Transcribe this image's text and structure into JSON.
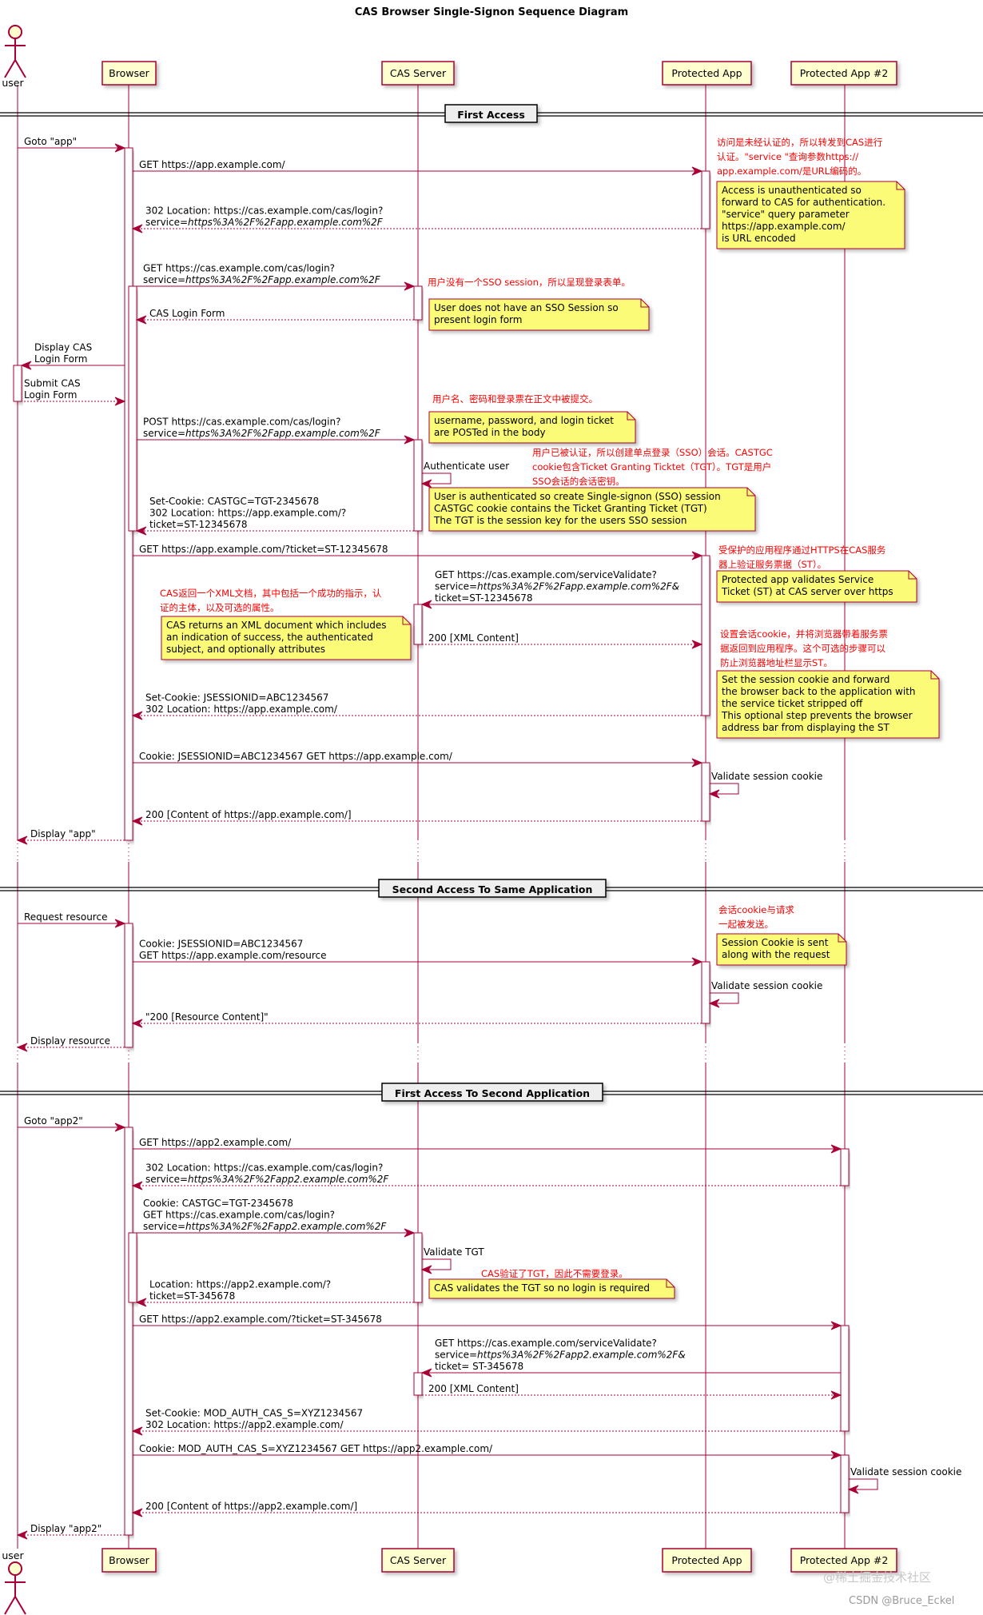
{
  "title": "CAS Browser Single-Signon Sequence Diagram",
  "colors": {
    "line": "#A80036",
    "participant_fill": "#FEFECE",
    "note_fill": "#FBFB77",
    "annotation_text": "#FF0000",
    "divider_fill": "#EEEEEE"
  },
  "participants": [
    {
      "id": "user",
      "label": "user",
      "type": "actor"
    },
    {
      "id": "browser",
      "label": "Browser",
      "type": "participant"
    },
    {
      "id": "cas",
      "label": "CAS Server",
      "type": "participant"
    },
    {
      "id": "app",
      "label": "Protected App",
      "type": "participant"
    },
    {
      "id": "app2",
      "label": "Protected App #2",
      "type": "participant"
    }
  ],
  "dividers": [
    {
      "label": "First Access"
    },
    {
      "label": "Second Access To Same Application"
    },
    {
      "label": "First Access To Second Application"
    }
  ],
  "messages": [
    {
      "from": "user",
      "to": "browser",
      "style": "solid",
      "lines": [
        "Goto \"app\""
      ]
    },
    {
      "from": "browser",
      "to": "app",
      "style": "solid",
      "lines": [
        "GET https://app.example.com/"
      ]
    },
    {
      "from": "app",
      "to": "browser",
      "style": "dashed",
      "lines": [
        "302 Location: https://cas.example.com/cas/login?",
        "service=|https%3A%2F%2Fapp.example.com%2F"
      ]
    },
    {
      "from": "browser",
      "to": "cas",
      "style": "solid",
      "lines": [
        "GET https://cas.example.com/cas/login?",
        "service=|https%3A%2F%2Fapp.example.com%2F"
      ]
    },
    {
      "from": "cas",
      "to": "browser",
      "style": "dashed",
      "lines": [
        "CAS Login Form"
      ]
    },
    {
      "from": "browser",
      "to": "user",
      "style": "solid",
      "lines": [
        "Display CAS",
        "Login Form"
      ]
    },
    {
      "from": "user",
      "to": "browser",
      "style": "dashed",
      "lines": [
        "Submit CAS",
        "Login Form"
      ]
    },
    {
      "from": "browser",
      "to": "cas",
      "style": "solid",
      "lines": [
        "POST https://cas.example.com/cas/login?",
        "service=|https%3A%2F%2Fapp.example.com%2F"
      ]
    },
    {
      "from": "cas",
      "to": "cas",
      "style": "self",
      "lines": [
        "Authenticate user"
      ]
    },
    {
      "from": "cas",
      "to": "browser",
      "style": "dashed",
      "lines": [
        "Set-Cookie: CASTGC=TGT-2345678",
        "302 Location: https://app.example.com/?",
        "ticket=ST-12345678"
      ]
    },
    {
      "from": "browser",
      "to": "app",
      "style": "solid",
      "lines": [
        "GET https://app.example.com/?ticket=ST-12345678"
      ]
    },
    {
      "from": "app",
      "to": "cas",
      "style": "solid",
      "lines": [
        "GET https://cas.example.com/serviceValidate?",
        "service=|https%3A%2F%2Fapp.example.com%2F&",
        "ticket=ST-12345678"
      ]
    },
    {
      "from": "cas",
      "to": "app",
      "style": "dashed",
      "lines": [
        "200 [XML Content]"
      ]
    },
    {
      "from": "app",
      "to": "browser",
      "style": "dashed",
      "lines": [
        "Set-Cookie: JSESSIONID=ABC1234567",
        "302 Location: https://app.example.com/"
      ]
    },
    {
      "from": "browser",
      "to": "app",
      "style": "solid",
      "lines": [
        "Cookie: JSESSIONID=ABC1234567 GET https://app.example.com/"
      ]
    },
    {
      "from": "app",
      "to": "app",
      "style": "self",
      "lines": [
        "Validate session cookie"
      ]
    },
    {
      "from": "app",
      "to": "browser",
      "style": "dashed",
      "lines": [
        "200 [Content of https://app.example.com/]"
      ]
    },
    {
      "from": "browser",
      "to": "user",
      "style": "dashed",
      "lines": [
        "Display \"app\""
      ]
    },
    {
      "from": "user",
      "to": "browser",
      "style": "solid",
      "lines": [
        "Request resource"
      ]
    },
    {
      "from": "browser",
      "to": "app",
      "style": "solid",
      "lines": [
        "Cookie: JSESSIONID=ABC1234567",
        "GET https://app.example.com/resource"
      ]
    },
    {
      "from": "app",
      "to": "app",
      "style": "self",
      "lines": [
        "Validate session cookie"
      ]
    },
    {
      "from": "app",
      "to": "browser",
      "style": "dashed",
      "lines": [
        "\"200 [Resource Content]\""
      ]
    },
    {
      "from": "browser",
      "to": "user",
      "style": "dashed",
      "lines": [
        "Display resource"
      ]
    },
    {
      "from": "user",
      "to": "browser",
      "style": "solid",
      "lines": [
        "Goto \"app2\""
      ]
    },
    {
      "from": "browser",
      "to": "app2",
      "style": "solid",
      "lines": [
        "GET https://app2.example.com/"
      ]
    },
    {
      "from": "app2",
      "to": "browser",
      "style": "dashed",
      "lines": [
        "302 Location: https://cas.example.com/cas/login?",
        "service=|https%3A%2F%2Fapp2.example.com%2F"
      ]
    },
    {
      "from": "browser",
      "to": "cas",
      "style": "solid",
      "lines": [
        "Cookie: CASTGC=TGT-2345678",
        "GET https://cas.example.com/cas/login?",
        "service=|https%3A%2F%2Fapp2.example.com%2F"
      ]
    },
    {
      "from": "cas",
      "to": "cas",
      "style": "self",
      "lines": [
        "Validate TGT"
      ]
    },
    {
      "from": "cas",
      "to": "browser",
      "style": "dashed",
      "lines": [
        "Location: https://app2.example.com/?",
        "ticket=ST-345678"
      ]
    },
    {
      "from": "browser",
      "to": "app2",
      "style": "solid",
      "lines": [
        "GET https://app2.example.com/?ticket=ST-345678"
      ]
    },
    {
      "from": "app2",
      "to": "cas",
      "style": "solid",
      "lines": [
        "GET https://cas.example.com/serviceValidate?",
        "service=|https%3A%2F%2Fapp2.example.com%2F&",
        "ticket= ST-345678"
      ]
    },
    {
      "from": "cas",
      "to": "app2",
      "style": "dashed",
      "lines": [
        "200 [XML Content]"
      ]
    },
    {
      "from": "app2",
      "to": "browser",
      "style": "dashed",
      "lines": [
        "Set-Cookie: MOD_AUTH_CAS_S=XYZ1234567",
        "302 Location: https://app2.example.com/"
      ]
    },
    {
      "from": "browser",
      "to": "app2",
      "style": "solid",
      "lines": [
        "Cookie: MOD_AUTH_CAS_S=XYZ1234567 GET https://app2.example.com/"
      ]
    },
    {
      "from": "app2",
      "to": "app2",
      "style": "self",
      "lines": [
        "Validate session cookie"
      ]
    },
    {
      "from": "app2",
      "to": "browser",
      "style": "dashed",
      "lines": [
        "200 [Content of https://app2.example.com/]"
      ]
    },
    {
      "from": "browser",
      "to": "user",
      "style": "dashed",
      "lines": [
        "Display \"app2\""
      ]
    }
  ],
  "notes": [
    {
      "lines": [
        "Access is unauthenticated so",
        "forward to CAS for authentication.",
        "\"service\" query parameter",
        "https://app.example.com/",
        "is URL encoded"
      ],
      "annotation": [
        "访问是未经认证的，所以转发到CAS进行",
        "认证。\"service \"查询参数https://",
        "app.example.com/是URL编码的。"
      ]
    },
    {
      "lines": [
        "User does not have an SSO Session so",
        "present login form"
      ],
      "annotation": [
        "用户没有一个SSO session，所以呈现登录表单。"
      ]
    },
    {
      "lines": [
        "username, password, and login ticket",
        "are POSTed in the body"
      ],
      "annotation": [
        "用户名、密码和登录票在正文中被提交。"
      ]
    },
    {
      "lines": [
        "User is authenticated so create Single-signon (SSO) session",
        "CASTGC cookie contains the Ticket Granting Ticket (TGT)",
        "The TGT is the session key for the users SSO session"
      ],
      "annotation": [
        "用户已被认证，所以创建单点登录（SSO）会话。CASTGC",
        "cookie包含Ticket Granting Ticktet（TGT）。TGT是用户",
        "SSO会话的会话密钥。"
      ]
    },
    {
      "lines": [
        "Protected app validates Service",
        "Ticket (ST) at CAS server over https"
      ],
      "annotation": [
        "受保护的应用程序通过HTTPS在CAS服务",
        "器上验证服务票据（ST）。"
      ]
    },
    {
      "lines": [
        "CAS returns an XML document which includes",
        "an indication of success, the authenticated",
        "subject, and optionally attributes"
      ],
      "annotation": [
        "CAS返回一个XML文档，其中包括一个成功的指示，认",
        "证的主体，以及可选的属性。"
      ]
    },
    {
      "lines": [
        "Set the session cookie and forward",
        "the browser back to the application with",
        "the service ticket stripped off",
        "This optional step prevents the browser",
        "address bar from displaying the ST"
      ],
      "annotation": [
        "设置会话cookie，并将浏览器带着服务票",
        "据返回到应用程序。这个可选的步骤可以",
        "防止浏览器地址栏显示ST。"
      ]
    },
    {
      "lines": [
        "Session Cookie is sent",
        "along with the request"
      ],
      "annotation": [
        "会话cookie与请求",
        "一起被发送。"
      ]
    },
    {
      "lines": [
        "CAS validates the TGT so no login is required"
      ],
      "annotation": [
        "CAS验证了TGT，因此不需要登录。"
      ]
    }
  ],
  "watermarks": [
    "@稀土掘金技术社区",
    "CSDN @Bruce_Eckel"
  ]
}
